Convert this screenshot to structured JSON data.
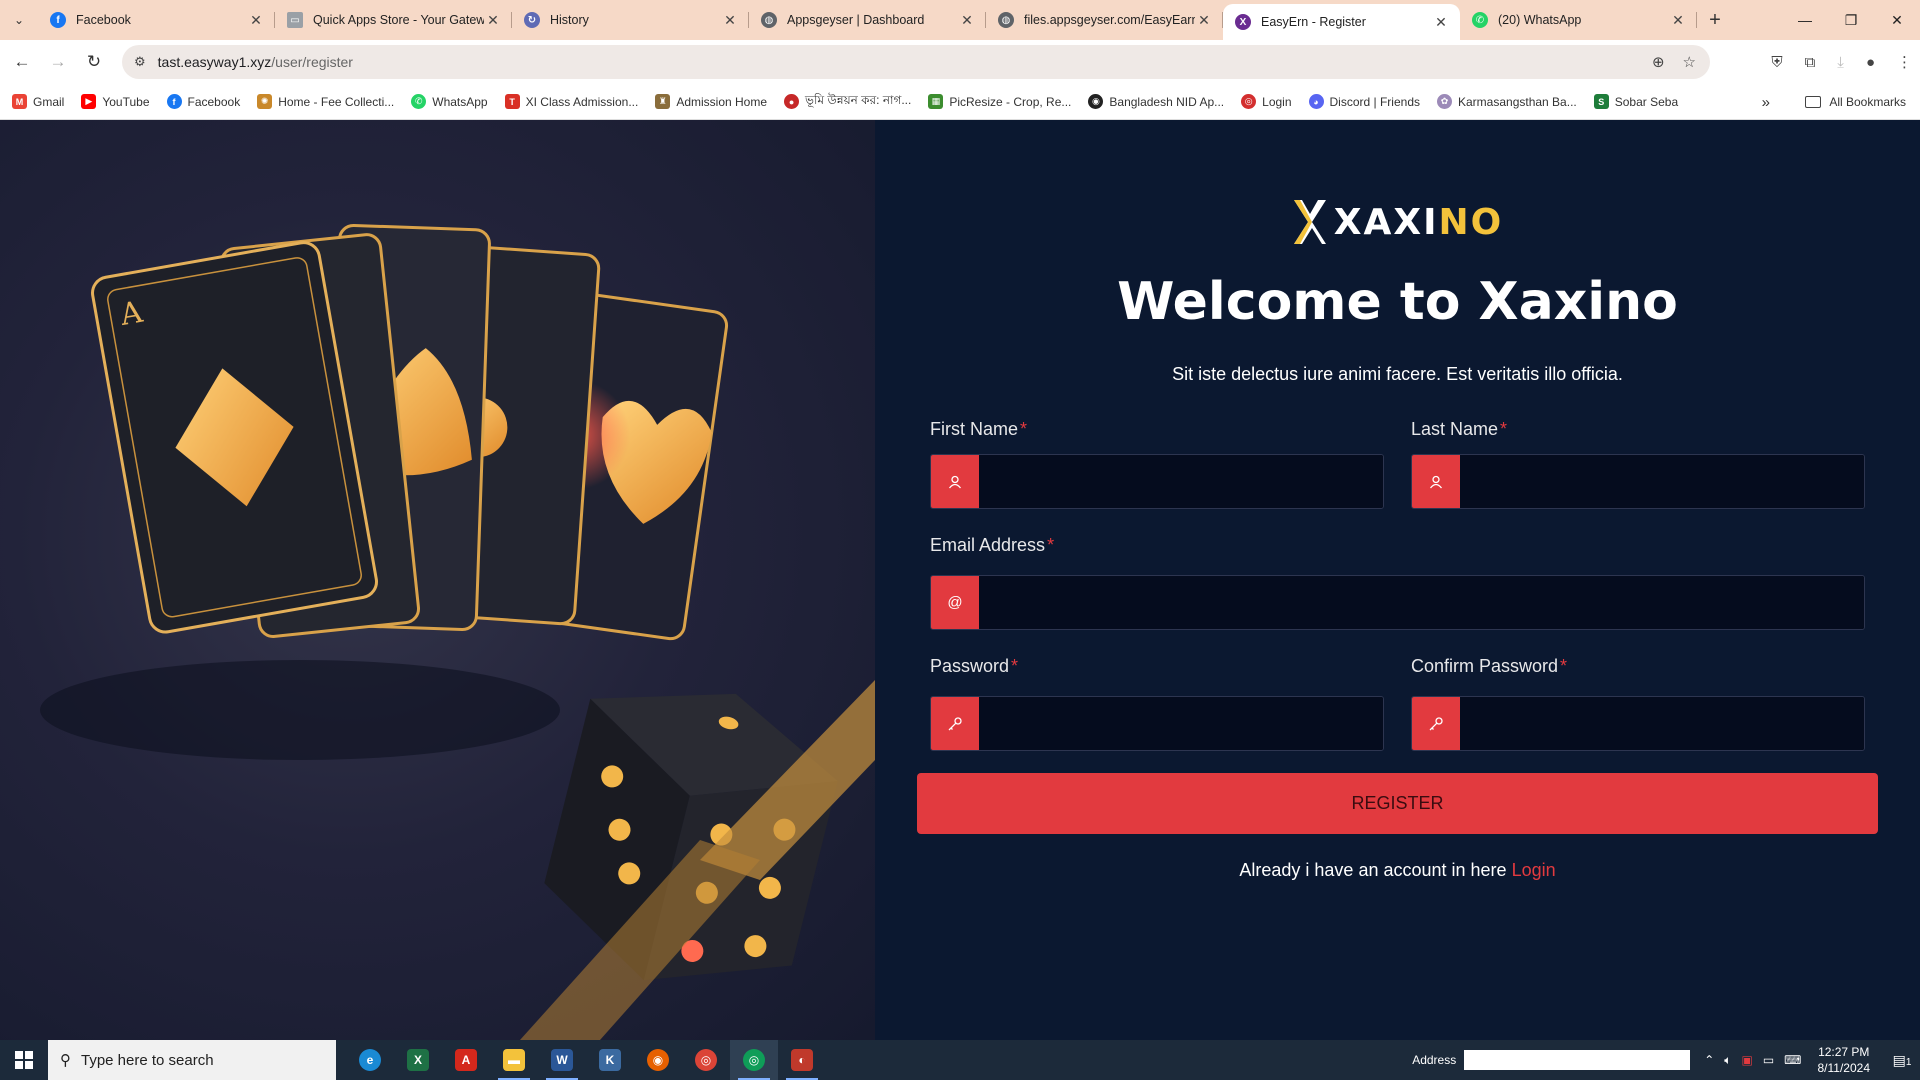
{
  "browser": {
    "tabs": [
      {
        "title": "Facebook",
        "favicon": "facebook-icon",
        "color": "#1877f2",
        "glyph": "f"
      },
      {
        "title": "Quick Apps Store - Your Gatew",
        "favicon": "page-icon",
        "color": "#9aa0a6",
        "glyph": "▭"
      },
      {
        "title": "History",
        "favicon": "history-icon",
        "color": "#5f6bb5",
        "glyph": "↻"
      },
      {
        "title": "Appsgeyser | Dashboard",
        "favicon": "globe-icon",
        "color": "#5f6368",
        "glyph": "◍"
      },
      {
        "title": "files.appsgeyser.com/EasyEarn_",
        "favicon": "globe-icon",
        "color": "#5f6368",
        "glyph": "◍"
      },
      {
        "title": "EasyErn - Register",
        "favicon": "xaxino-icon",
        "color": "#6a2c91",
        "glyph": "X"
      },
      {
        "title": "(20) WhatsApp",
        "favicon": "whatsapp-icon",
        "color": "#25d366",
        "glyph": "✆"
      }
    ],
    "url_host": "tast.easyway1.xyz",
    "url_path": "/user/register",
    "bookmarks": [
      {
        "label": "Gmail",
        "color": "#ea4335",
        "glyph": "M"
      },
      {
        "label": "YouTube",
        "color": "#ff0000",
        "glyph": "▶"
      },
      {
        "label": "Facebook",
        "color": "#1877f2",
        "glyph": "f"
      },
      {
        "label": "Home - Fee Collecti...",
        "color": "#c9882a",
        "glyph": "✺"
      },
      {
        "label": "WhatsApp",
        "color": "#25d366",
        "glyph": "✆"
      },
      {
        "label": "XI Class Admission...",
        "color": "#d93025",
        "glyph": "T"
      },
      {
        "label": "Admission Home",
        "color": "#8a6d3b",
        "glyph": "♜"
      },
      {
        "label": "ভূমি উন্নয়ন কর: নাগ...",
        "color": "#c62828",
        "glyph": "●"
      },
      {
        "label": "PicResize - Crop, Re...",
        "color": "#3c8d2f",
        "glyph": "▦"
      },
      {
        "label": "Bangladesh NID Ap...",
        "color": "#222222",
        "glyph": "◉"
      },
      {
        "label": "Login",
        "color": "#d32f2f",
        "glyph": "◎"
      },
      {
        "label": "Discord | Friends",
        "color": "#5865f2",
        "glyph": "◕"
      },
      {
        "label": "Karmasangsthan Ba...",
        "color": "#9c8ab8",
        "glyph": "✿"
      },
      {
        "label": "Sobar Seba",
        "color": "#1e7d3a",
        "glyph": "S"
      }
    ],
    "all_bookmarks": "All Bookmarks"
  },
  "page": {
    "logo": {
      "part1": "XAXI",
      "part2": "NO"
    },
    "welcome": "Welcome to Xaxino",
    "subtitle": "Sit iste delectus iure animi facere. Est veritatis illo officia.",
    "fields": {
      "first_name": {
        "label": "First Name",
        "value": "",
        "icon": "user-icon"
      },
      "last_name": {
        "label": "Last Name",
        "value": "",
        "icon": "user-icon"
      },
      "email": {
        "label": "Email Address",
        "value": "",
        "icon": "at-icon"
      },
      "password": {
        "label": "Password",
        "value": "",
        "icon": "key-icon"
      },
      "confirm_password": {
        "label": "Confirm Password",
        "value": "",
        "icon": "key-icon"
      }
    },
    "required_mark": "*",
    "register_label": "Register",
    "already_text": "Already i have an account in here",
    "login_label": "Login",
    "colors": {
      "accent": "#e23a3f",
      "panel": "#0b1830",
      "gold": "#f3c23b"
    }
  },
  "taskbar": {
    "search_placeholder": "Type here to search",
    "address_label": "Address",
    "time": "12:27 PM",
    "date": "8/11/2024",
    "notification_count": "1"
  }
}
